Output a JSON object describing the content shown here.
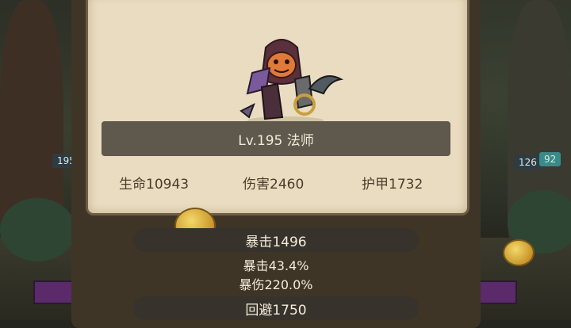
{
  "hero": {
    "level_class": "Lv.195 法师",
    "stats": [
      {
        "label": "生命10943"
      },
      {
        "label": "伤害2460"
      },
      {
        "label": "护甲1732"
      }
    ]
  },
  "details": {
    "crit_value": "暴击1496",
    "crit_rate": "暴击43.4%",
    "crit_damage": "暴伤220.0%",
    "dodge_value": "回避1750"
  },
  "background": {
    "left_badge": "195",
    "right_badge_1": "126",
    "right_badge_2": "92"
  },
  "colors": {
    "card": "#eadcc0",
    "pill": "#37322b",
    "level_bar": "#5f594d"
  }
}
